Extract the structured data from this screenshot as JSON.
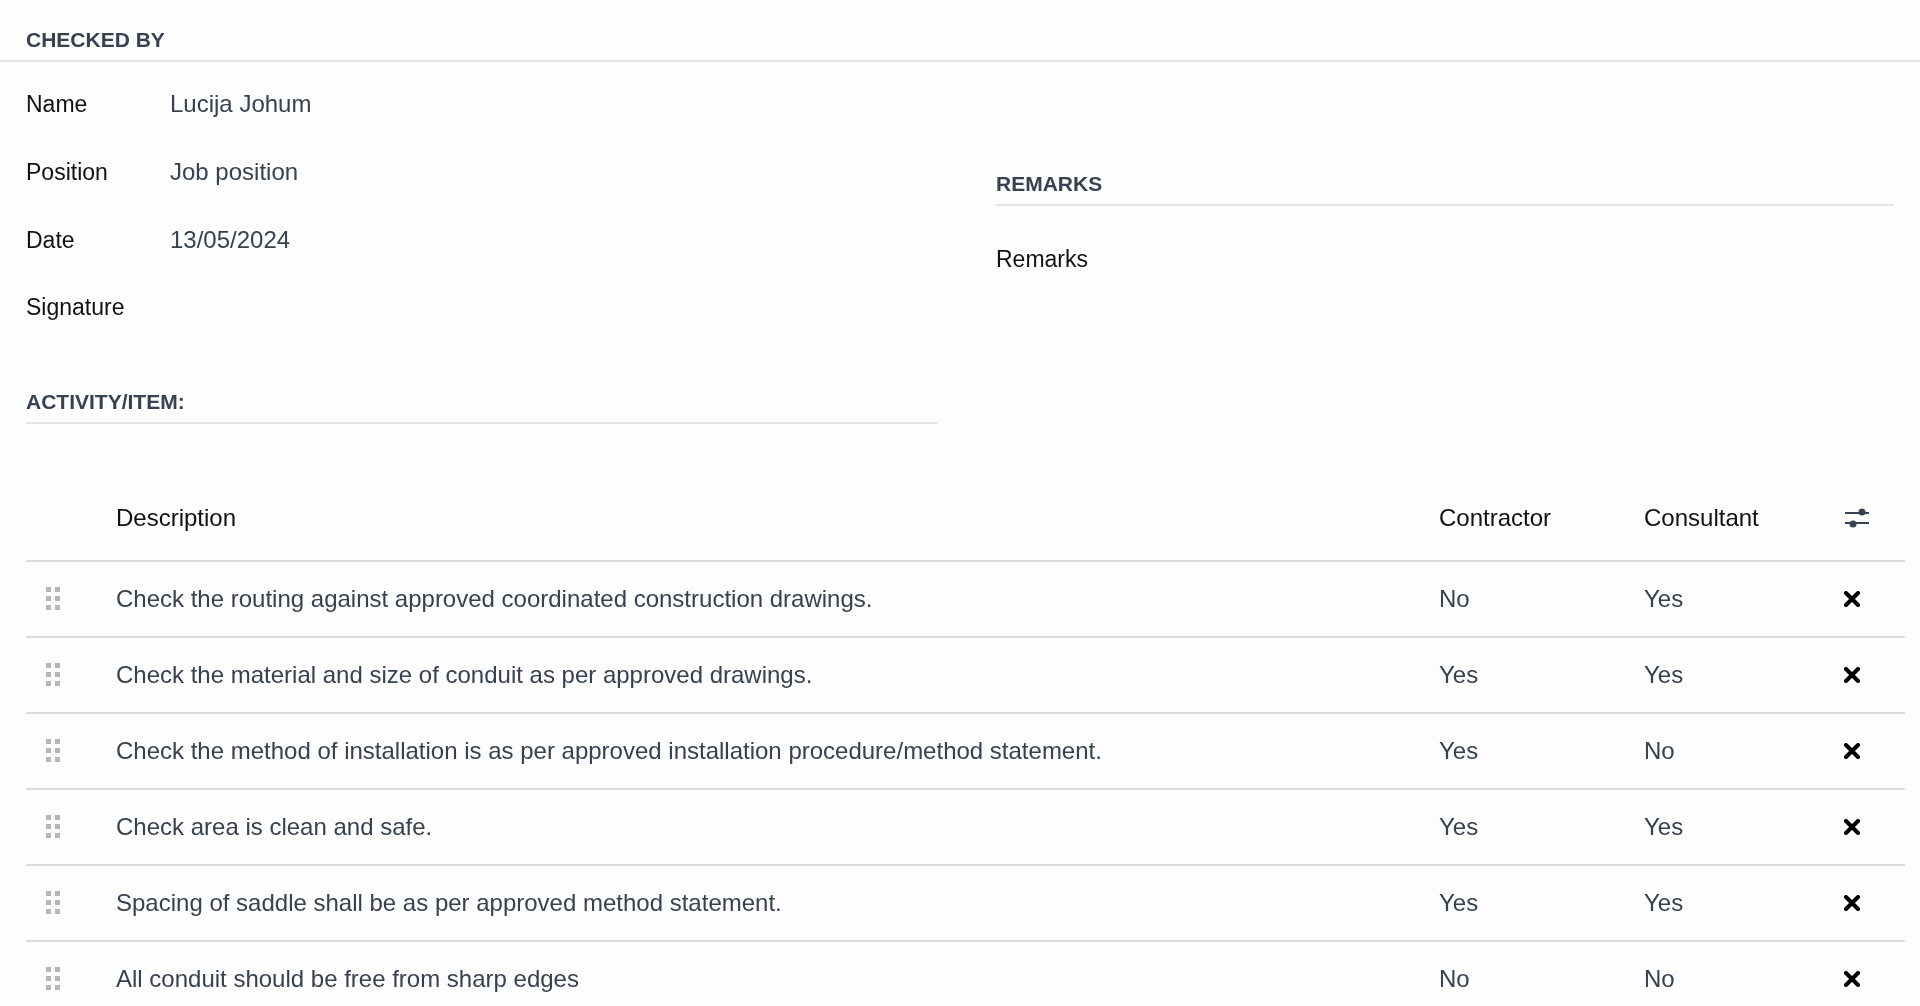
{
  "checked_by": {
    "heading": "CHECKED BY",
    "fields": [
      {
        "label": "Name",
        "value": "Lucija Johum"
      },
      {
        "label": "Position",
        "value": "Job position"
      },
      {
        "label": "Date",
        "value": "13/05/2024"
      },
      {
        "label": "Signature"
      }
    ]
  },
  "remarks": {
    "heading": "REMARKS",
    "label": "Remarks"
  },
  "activity": {
    "heading": "ACTIVITY/ITEM:"
  },
  "table": {
    "columns": [
      "Description",
      "Contractor",
      "Consultant"
    ],
    "rows": [
      {
        "description": "Check the routing against approved coordinated construction drawings.",
        "contractor": "No",
        "consultant": "Yes"
      },
      {
        "description": "Check the material and size of conduit as per approved drawings.",
        "contractor": "Yes",
        "consultant": "Yes"
      },
      {
        "description": "Check the method of installation is as per approved installation procedure/method statement.",
        "contractor": "Yes",
        "consultant": "No"
      },
      {
        "description": "Check area is clean and safe.",
        "contractor": "Yes",
        "consultant": "Yes"
      },
      {
        "description": "Spacing of saddle shall be as per approved method statement.",
        "contractor": "Yes",
        "consultant": "Yes"
      },
      {
        "description": "All conduit should be free from sharp edges",
        "contractor": "No",
        "consultant": "No"
      }
    ]
  }
}
